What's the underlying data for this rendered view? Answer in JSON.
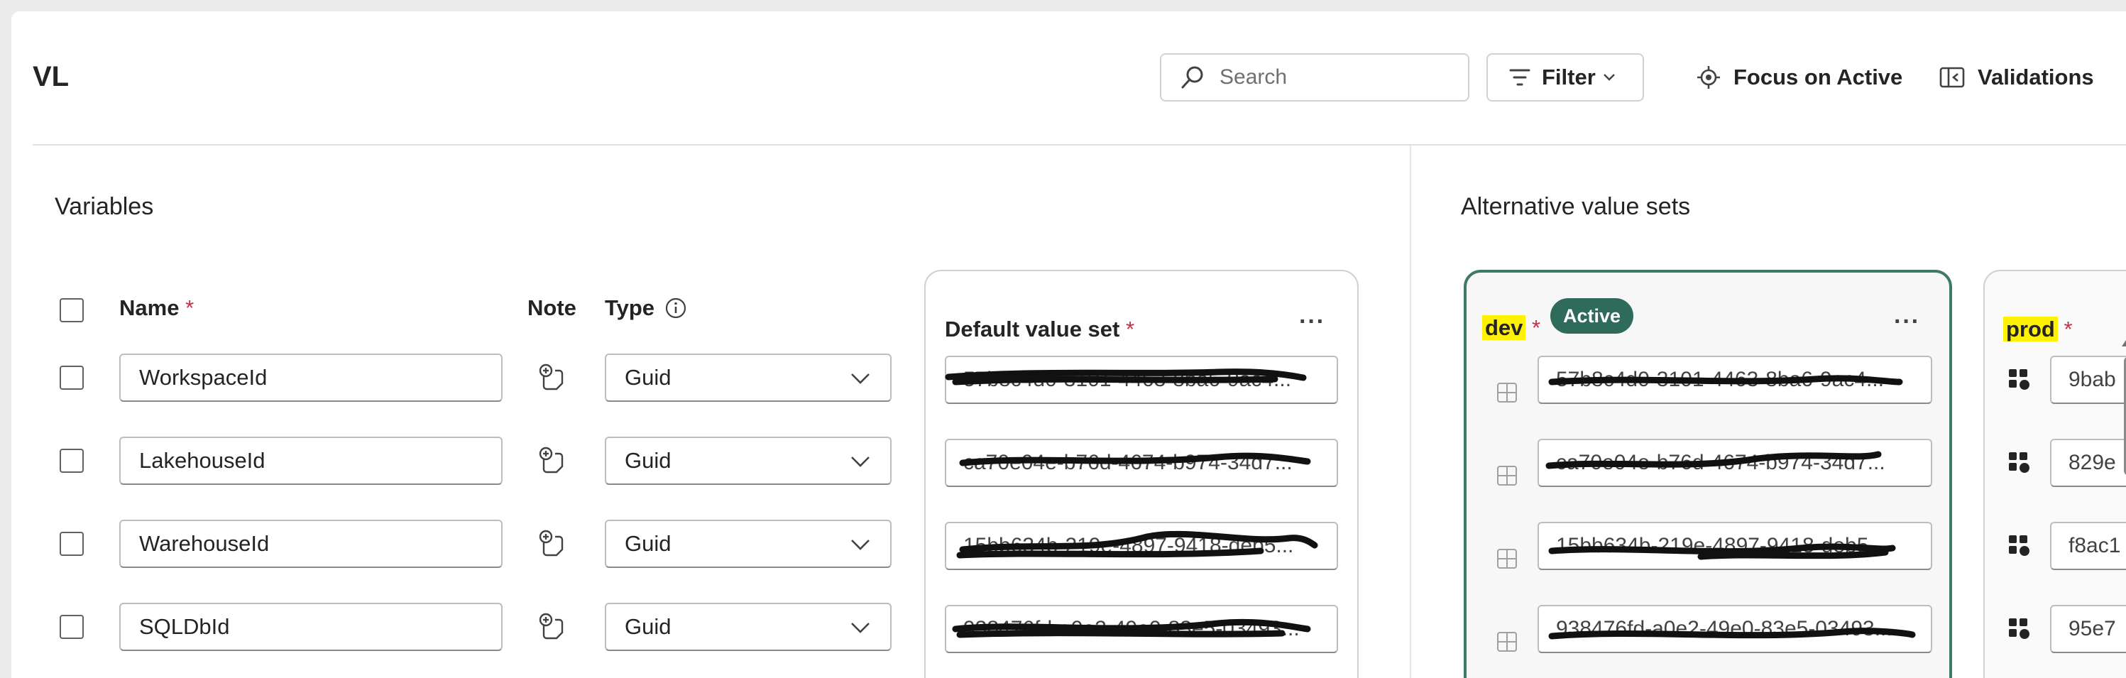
{
  "header": {
    "title": "VL",
    "search": {
      "placeholder": "Search",
      "value": ""
    },
    "filter_label": "Filter",
    "focus_label": "Focus on Active",
    "validations_label": "Validations"
  },
  "variables": {
    "section_title": "Variables",
    "columns": {
      "name": "Name",
      "note": "Note",
      "type": "Type"
    },
    "required_mark": "*",
    "rows": [
      {
        "name": "WorkspaceId",
        "type": "Guid",
        "default_value": "57b8c4d0-3101-4463-8ba6-9ac4..."
      },
      {
        "name": "LakehouseId",
        "type": "Guid",
        "default_value": "ca70e04e-b76d-4674-b974-34d7..."
      },
      {
        "name": "WarehouseId",
        "type": "Guid",
        "default_value": "15bb634b-219e-4897-9418-deb5..."
      },
      {
        "name": "SQLDbId",
        "type": "Guid",
        "default_value": "938476fd-a0e2-49e0-83e5-03493..."
      }
    ]
  },
  "default_set": {
    "title": "Default value set",
    "more": "···"
  },
  "alternatives": {
    "section_title": "Alternative value sets",
    "dev": {
      "name": "dev",
      "badge": "Active",
      "more": "···",
      "values": [
        "57b8c4d0-3101-4463-8ba6-9ac4...",
        "ca70e04e-b76d-4674-b974-34d7...",
        "15bb634b-219e-4897-9418-deb5...",
        "938476fd-a0e2-49e0-83e5-03493..."
      ]
    },
    "prod": {
      "name": "prod",
      "values": [
        "9bab",
        "829e",
        "f8ac1",
        "95e7"
      ]
    }
  },
  "colors": {
    "accent": "#2f6b5a",
    "highlight": "#fff200",
    "required": "#c4314b"
  },
  "icons": [
    "search-icon",
    "filter-icon",
    "chevron-down-icon",
    "focus-icon",
    "validations-icon",
    "info-icon",
    "note-add-icon",
    "grid-cell-icon",
    "overridden-icon"
  ]
}
